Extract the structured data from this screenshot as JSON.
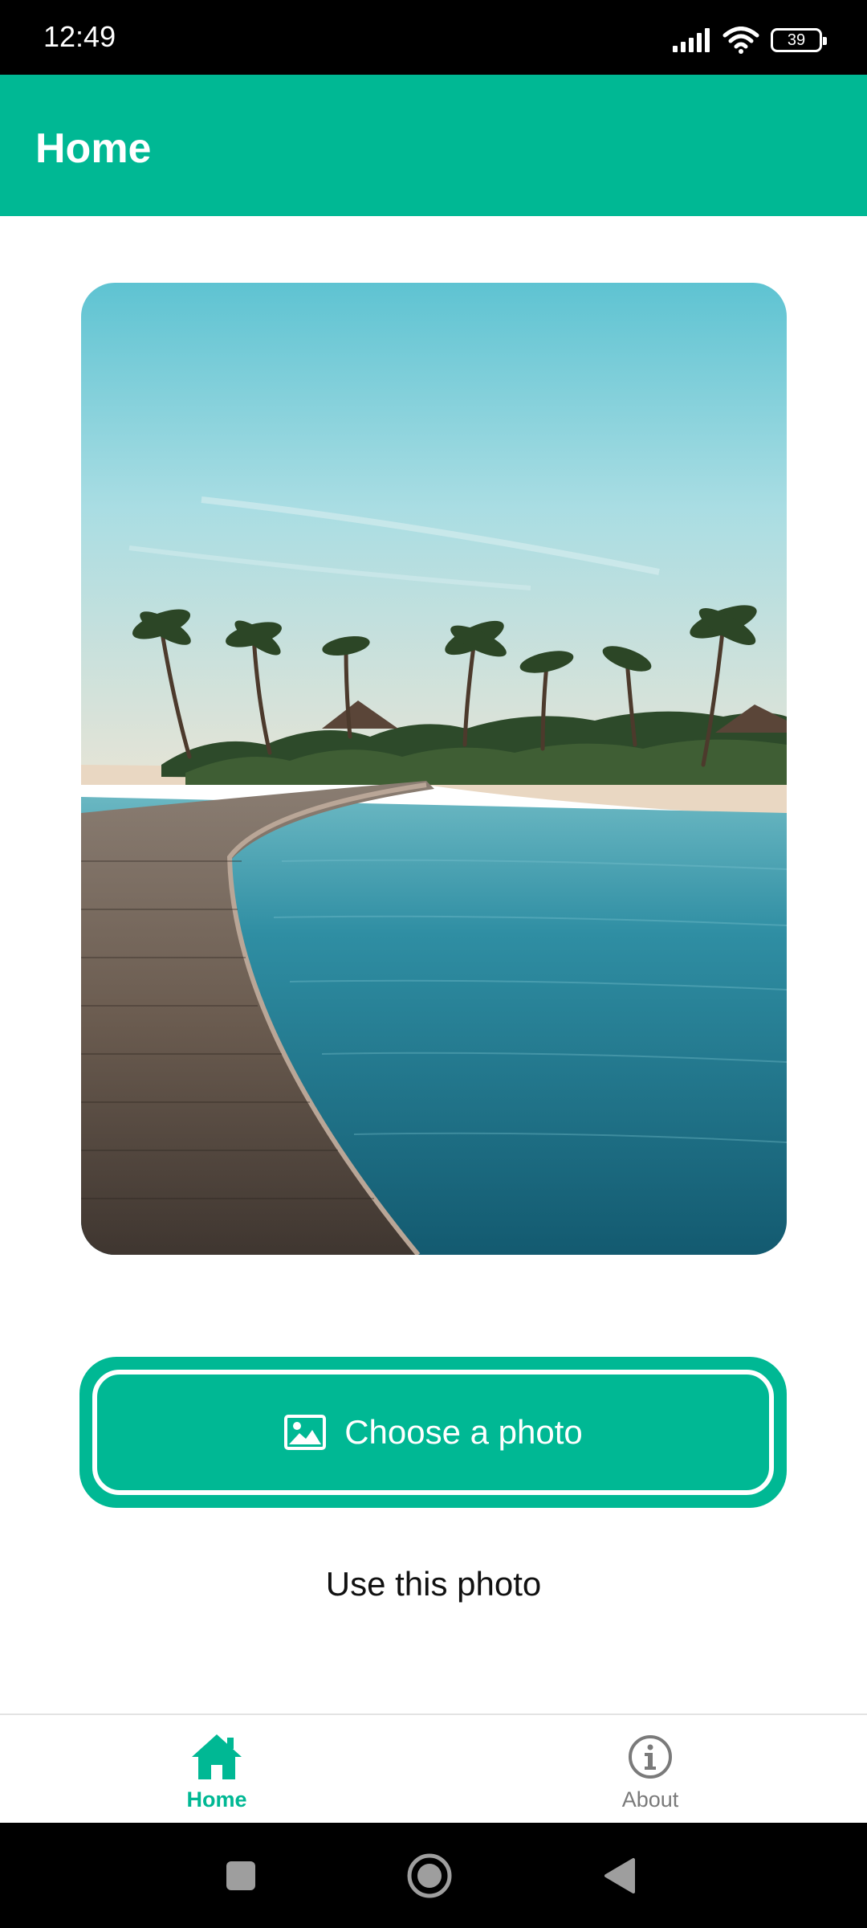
{
  "status_bar": {
    "time": "12:49",
    "battery": "39",
    "icons": [
      "signal-icon",
      "wifi-icon",
      "battery-icon"
    ]
  },
  "app_bar": {
    "title": "Home"
  },
  "main": {
    "photo_subject": "tropical beach boardwalk with palm trees",
    "choose_button": {
      "label": "Choose a photo",
      "icon": "image-icon"
    },
    "use_button": {
      "label": "Use this photo"
    }
  },
  "bottom_nav": {
    "items": [
      {
        "label": "Home",
        "icon": "home-icon",
        "active": true
      },
      {
        "label": "About",
        "icon": "info-icon",
        "active": false
      }
    ]
  },
  "system_nav": {
    "buttons": [
      "recents-icon",
      "home-circle-icon",
      "back-icon"
    ]
  },
  "colors": {
    "accent": "#00b894",
    "status_bar": "#000000",
    "inactive": "#7a7a7a"
  }
}
